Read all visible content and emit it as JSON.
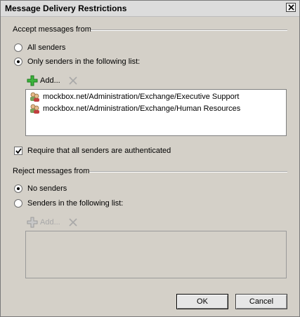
{
  "window": {
    "title": "Message Delivery Restrictions"
  },
  "accept": {
    "heading": "Accept messages from",
    "all_senders": "All senders",
    "only_senders": "Only senders in the following list:",
    "add_label": "Add...",
    "entries": [
      "mockbox.net/Administration/Exchange/Executive Support",
      "mockbox.net/Administration/Exchange/Human Resources"
    ],
    "require_auth": "Require that all senders are authenticated"
  },
  "reject": {
    "heading": "Reject messages from",
    "no_senders": "No senders",
    "senders_list": "Senders in the following list:",
    "add_label": "Add..."
  },
  "buttons": {
    "ok": "OK",
    "cancel": "Cancel"
  },
  "colors": {
    "dialog_bg": "#d4d0c8",
    "add_icon": "#3cb43c"
  }
}
